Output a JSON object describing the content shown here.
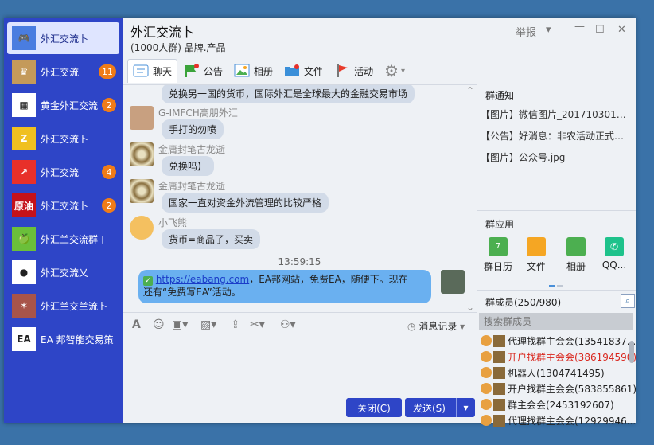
{
  "sidebar": {
    "items": [
      {
        "name": "外汇交流卜",
        "badge": "",
        "icon": "gamepad-icon",
        "avatar_text": "🎮",
        "bg": "#4a7de0"
      },
      {
        "name": "外汇交流",
        "badge": "11",
        "icon": "crown-avatar",
        "avatar_text": "♛",
        "bg": "#c49a5a"
      },
      {
        "name": "黄金外汇交流",
        "badge": "2",
        "icon": "qrcode-avatar",
        "avatar_text": "▦",
        "bg": "#ffffff"
      },
      {
        "name": "外汇交流卜",
        "badge": "",
        "icon": "zuw-logo-avatar",
        "avatar_text": "Z",
        "bg": "#f0c020"
      },
      {
        "name": "外汇交流",
        "badge": "4",
        "icon": "chart-up-avatar",
        "avatar_text": "↗",
        "bg": "#e8302a"
      },
      {
        "name": "外汇交流卜",
        "badge": "2",
        "icon": "oil-avatar",
        "avatar_text": "原油",
        "bg": "#c4121a"
      },
      {
        "name": "外汇兰交流群ㄒ",
        "badge": "",
        "icon": "apple-avatar",
        "avatar_text": "🍏",
        "bg": "#6bbf3a"
      },
      {
        "name": "外汇交流乂",
        "badge": "",
        "icon": "logo-avatar",
        "avatar_text": "●",
        "bg": "#ffffff"
      },
      {
        "name": "外汇兰交兰流卜",
        "badge": "",
        "icon": "pattern-avatar",
        "avatar_text": "✶",
        "bg": "#a8544a"
      },
      {
        "name": "EA 邦智能交易策",
        "badge": "",
        "icon": "ea-logo-avatar",
        "avatar_text": "EA",
        "bg": "#ffffff"
      }
    ]
  },
  "header": {
    "title": "外汇交流卜",
    "subtitle": "(1000人群) 品牌.产品",
    "report": "举报"
  },
  "tabs": [
    {
      "label": "聊天",
      "icon": "chat-icon",
      "color": "#4a90d9"
    },
    {
      "label": "公告",
      "icon": "flag-notice-icon",
      "color": "#3aa33a"
    },
    {
      "label": "相册",
      "icon": "album-icon",
      "color": "#4a90d9"
    },
    {
      "label": "文件",
      "icon": "folder-icon",
      "color": "#3a8fd9"
    },
    {
      "label": "活动",
      "icon": "activity-flag-icon",
      "color": "#e83a2a"
    }
  ],
  "chat": {
    "messages": [
      {
        "name": "",
        "text": "兑换另一国的货币，国际外汇是全球最大的金融交易市场",
        "avatar": "none"
      },
      {
        "name": "G-IMFCH高朋外汇",
        "text": "手打的勿喷",
        "avatar": "#c8a080"
      },
      {
        "name": "金庸封笔古龙逝",
        "text": "兑换吗】",
        "avatar": "#b8a470"
      },
      {
        "name": "金庸封笔古龙逝",
        "text": "国家一直对资金外流管理的比较严格",
        "avatar": "#b8a470"
      },
      {
        "name": "小飞熊",
        "text": "货币=商品了，买卖",
        "avatar": "#f4c060"
      }
    ],
    "time": "13:59:15",
    "own_message": {
      "link": "https://eabang.com",
      "text_after_link": "，EA邦网站，免费EA，随便下。现在",
      "line2": "还有“免费写EA”活动。"
    }
  },
  "input": {
    "history_label": "消息记录",
    "close_label": "关闭(C)",
    "send_label": "发送(S)"
  },
  "right": {
    "notice_title": "群通知",
    "notices": [
      "【图片】微信图片_2017103016362...",
      "【公告】好消息：非农活动正式上...",
      "【图片】公众号.jpg"
    ],
    "apps_title": "群应用",
    "apps": [
      {
        "label": "群日历",
        "color": "#4caf50",
        "icon": "calendar-icon"
      },
      {
        "label": "文件",
        "color": "#f5a623",
        "icon": "file-app-icon"
      },
      {
        "label": "相册",
        "color": "#4caf50",
        "icon": "photo-app-icon"
      },
      {
        "label": "QQ...",
        "color": "#1ec28b",
        "icon": "phone-app-icon"
      }
    ],
    "members_title": "群成员(250/980)",
    "search_placeholder": "搜索群成员",
    "members": [
      {
        "name": "代理找群主会会(13541837...",
        "color": "#222222"
      },
      {
        "name": "开户找群主会会(386194590)",
        "color": "#d9251c"
      },
      {
        "name": "机器人(1304741495)",
        "color": "#222222"
      },
      {
        "name": "开户找群主会会(583855861)",
        "color": "#222222"
      },
      {
        "name": "群主会会(2453192607)",
        "color": "#222222"
      },
      {
        "name": "代理找群主会会(12929946...",
        "color": "#222222"
      }
    ]
  }
}
